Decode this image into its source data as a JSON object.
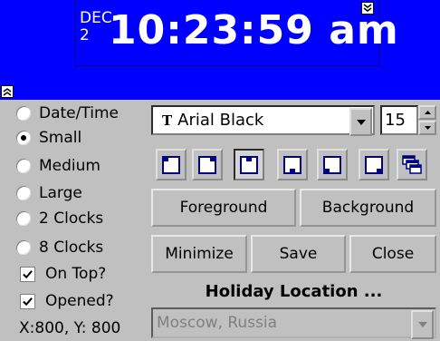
{
  "clock": {
    "month": "DEC",
    "day": "2",
    "time": "10:23:59 am"
  },
  "display_modes": [
    {
      "label": "Date/Time",
      "selected": false
    },
    {
      "label": "Small",
      "selected": true
    },
    {
      "label": "Medium",
      "selected": false
    },
    {
      "label": "Large",
      "selected": false
    },
    {
      "label": "2 Clocks",
      "selected": false
    },
    {
      "label": "8 Clocks",
      "selected": false
    }
  ],
  "options": {
    "on_top_label": "On Top?",
    "on_top_checked": true,
    "opened_label": "Opened?",
    "opened_checked": true
  },
  "position_readout": "X:800, Y: 800",
  "font": {
    "name": "Arial Black",
    "size": "15",
    "icon": "truetype-font-icon"
  },
  "alignment_buttons": [
    {
      "icon": "align-top-left-icon",
      "pressed": false
    },
    {
      "icon": "align-top-right-icon",
      "pressed": false
    },
    {
      "icon": "align-top-center-icon",
      "pressed": true
    },
    {
      "icon": "align-bottom-left-icon",
      "pressed": false
    },
    {
      "icon": "align-bottom-center-icon",
      "pressed": false
    },
    {
      "icon": "align-bottom-right-icon",
      "pressed": false
    },
    {
      "icon": "cascade-windows-icon",
      "pressed": false
    }
  ],
  "color_buttons": {
    "foreground": "Foreground",
    "background": "Background"
  },
  "action_buttons": {
    "minimize": "Minimize",
    "save": "Save",
    "close": "Close"
  },
  "holiday": {
    "title": "Holiday Location ...",
    "value": "Moscow, Russia"
  },
  "colors": {
    "clock_background": "#0000ff",
    "clock_text": "#ffffff",
    "panel": "#c0c0c0"
  }
}
